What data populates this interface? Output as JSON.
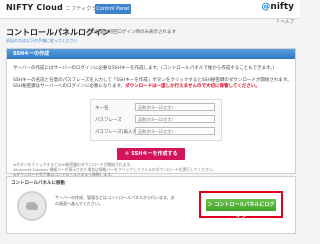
{
  "header": {
    "logo": "NIFTY Cloud",
    "logo_sub": "ニフティクラウド",
    "tab": "Control Panel",
    "brand_at": "@",
    "brand": "nifty",
    "help": "ヘルプ"
  },
  "page": {
    "title": "コントロールパネルログイン",
    "subtitle": "この画面は初回ログイン時のみ表示されます",
    "title_note": "初回の方は以下の手順に従ってください"
  },
  "ssh_panel": {
    "header": "SSHキーの作成",
    "p1": "サーバーの作成にはサーバーのログインに必要なSSHキーを作成します。(コントロールパネルで後から作成することもできます。)",
    "p2": "SSHキーの名前と任意のパスフレーズを入力して「SSHキーを作成」ボタンをクリックするとSSH秘密鍵のダウンロードが開始されます。",
    "p3_text": "SSH秘密鍵はサーバーへのログインに必要になります。",
    "p3_warning": "ダウンロードは一度しか行えませんので大切に保管してください。",
    "fields": [
      {
        "label": "キー名",
        "placeholder": "英数字(4〜32文字)"
      },
      {
        "label": "パスフレーズ",
        "placeholder": "英数字(4〜32文字)"
      },
      {
        "label": "パスフレーズ(再入力)",
        "placeholder": "英数字(4〜32文字)"
      }
    ],
    "create_button": "＋ SSHキーを作成する",
    "notes": [
      "※ボタンをクリックするとSSH秘密鍵のダウンロードが開始されます。",
      "※Internet Explorer 情報バーが表示された場合は情報バーをクリックしファイルのダウンロードを実行してください。",
      "※ダウンロード完了後はコントロールパネルへ移動します。"
    ]
  },
  "login_panel": {
    "header": "コントロールパネルに移動",
    "desc": "サーバーの作成、管理などはコントロールパネルから行います。次の画面へ進んでください。",
    "button": "＞ コントロールパネルにログイン"
  }
}
